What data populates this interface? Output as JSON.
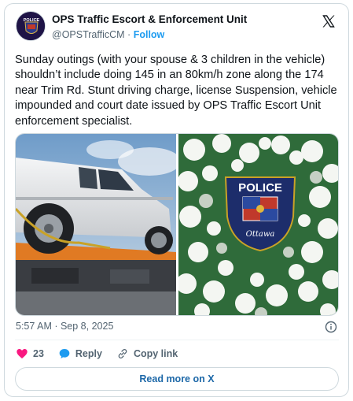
{
  "author": {
    "name": "OPS Traffic Escort & Enforcement Unit",
    "handle": "@OPSTrafficCM",
    "separator": "·",
    "follow_label": "Follow",
    "avatar_text": "POLICE"
  },
  "post": {
    "text": "Sunday outings (with your spouse & 3 children in the vehicle) shouldn’t include doing 145 in an 80km/h zone along the 174 near Trim Rd. Stunt driving charge, license Suspension, vehicle impounded and court date issued by OPS Traffic Escort Unit enforcement specialist.",
    "timestamp": "5:57 AM · Sep 8, 2025"
  },
  "media": {
    "badge_text": "POLICE",
    "badge_script": "Ottawa"
  },
  "actions": {
    "likes_count": "23",
    "reply_label": "Reply",
    "copy_link_label": "Copy link"
  },
  "read_more_label": "Read more on X",
  "colors": {
    "accent": "#1d9bf0",
    "like": "#f91880",
    "text_secondary": "#536471"
  }
}
